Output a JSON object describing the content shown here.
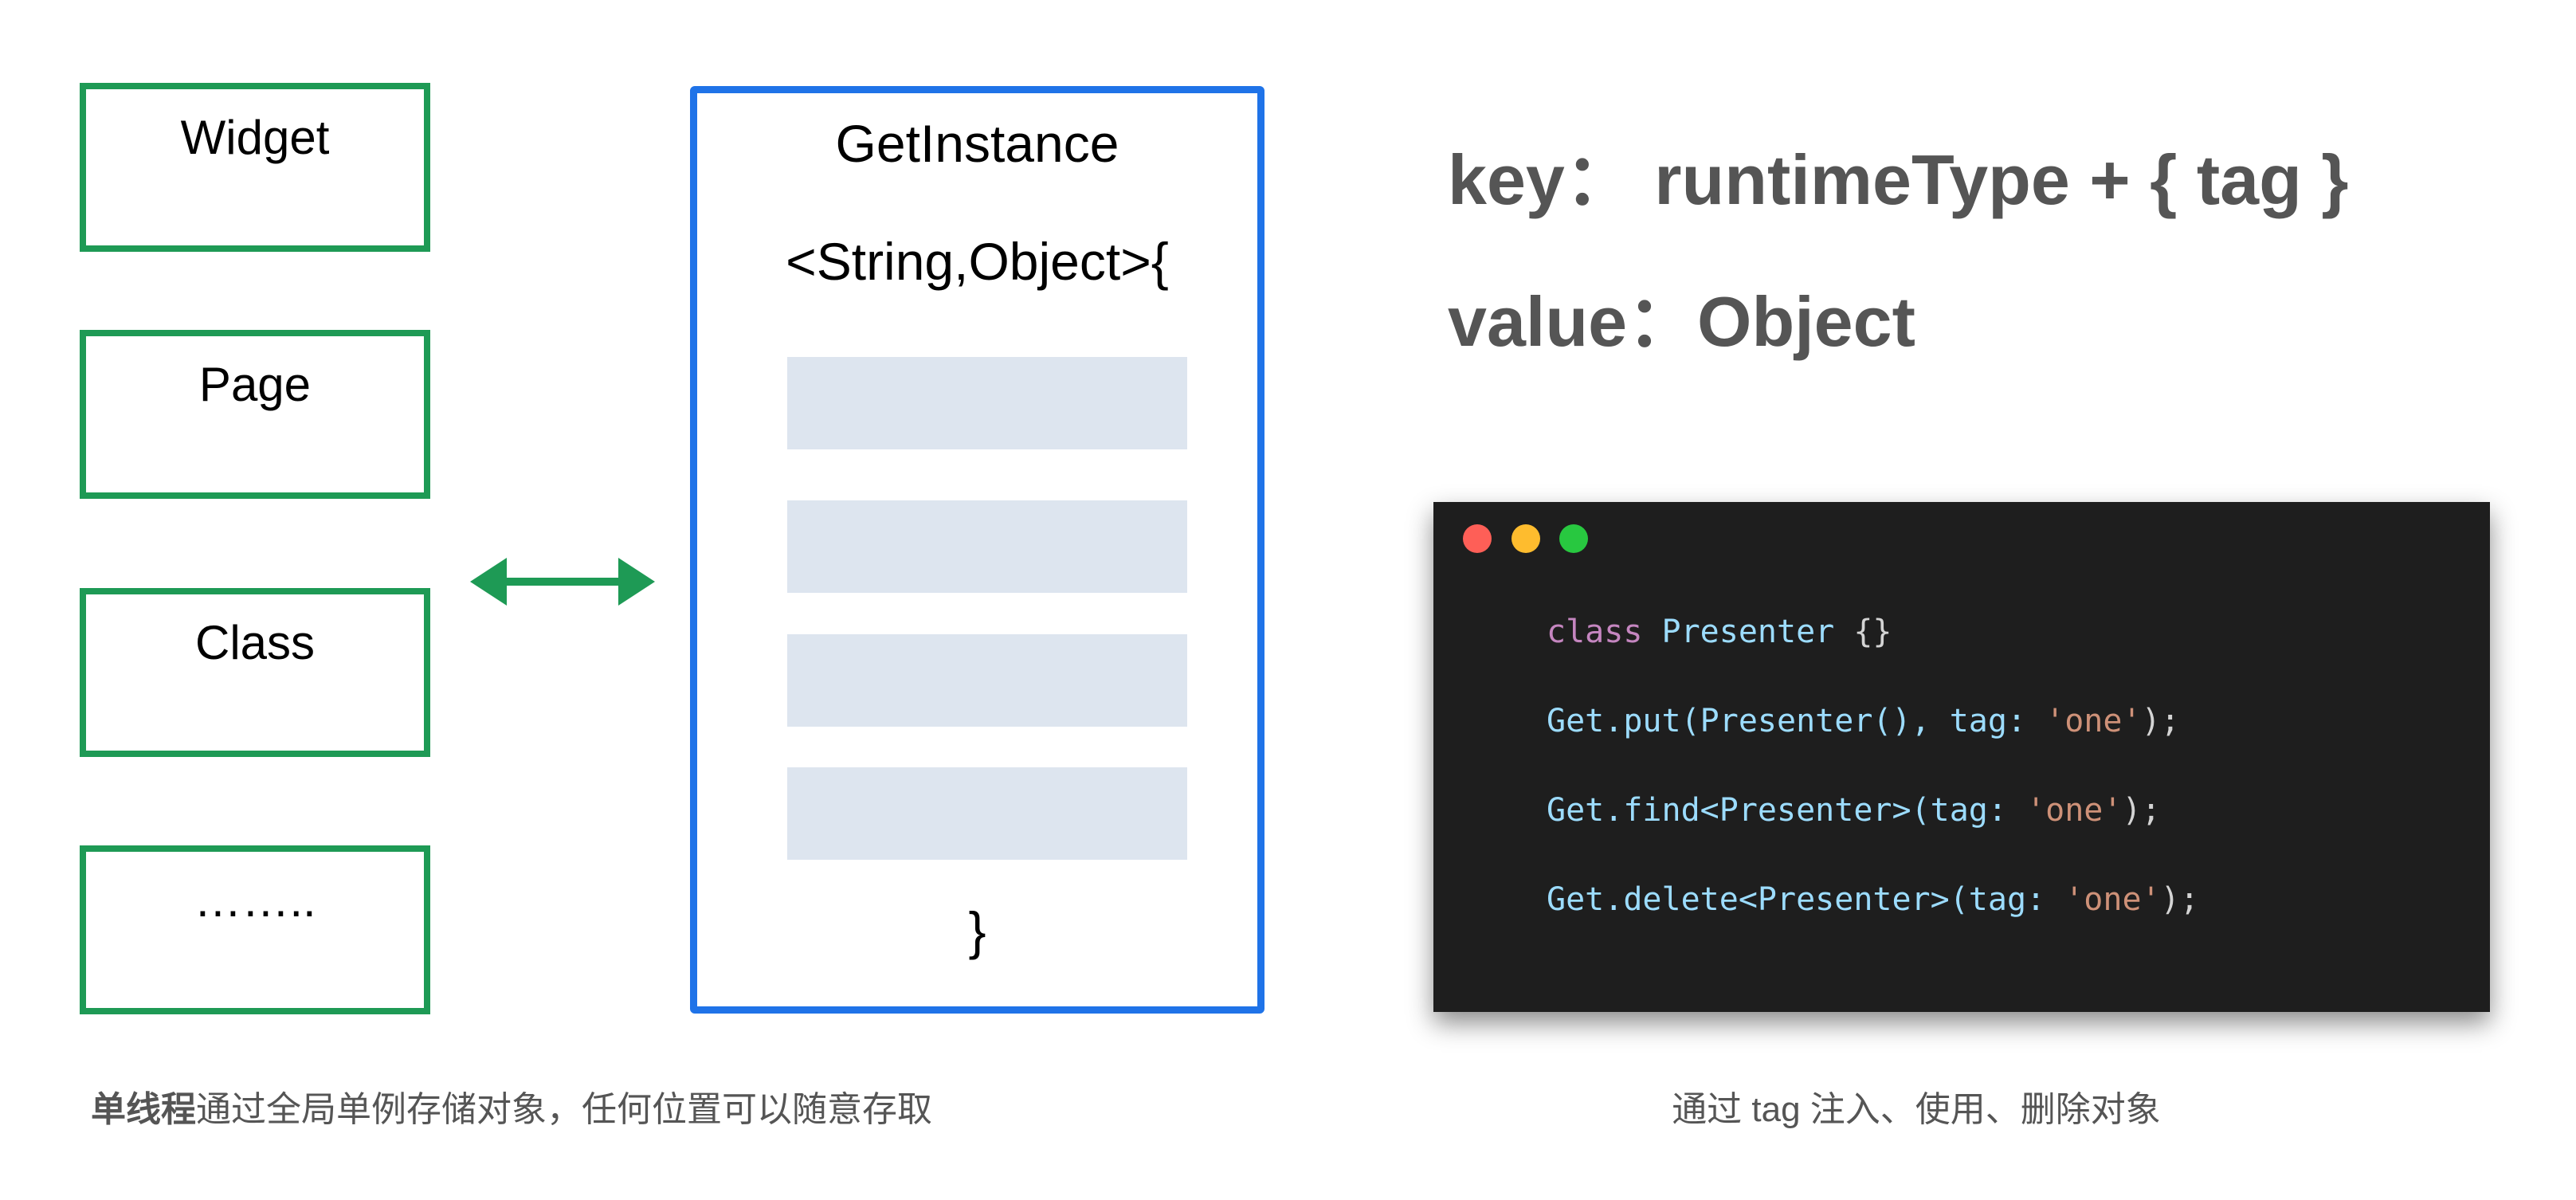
{
  "left_boxes": [
    "Widget",
    "Page",
    "Class",
    "…….."
  ],
  "container": {
    "title": "GetInstance",
    "generic": "<String,Object>{",
    "close": "}",
    "slot_count": 4
  },
  "key_line": {
    "label": "key：",
    "value": "runtimeType + { tag }"
  },
  "value_line": {
    "label": "value：",
    "value": "Object"
  },
  "code": {
    "lines": [
      [
        {
          "t": "class ",
          "c": "kw"
        },
        {
          "t": "Presenter ",
          "c": "cl"
        },
        {
          "t": "{}",
          "c": "pn"
        }
      ],
      [
        {
          "t": "Get.put(Presenter(), tag: ",
          "c": "cl"
        },
        {
          "t": "'one'",
          "c": "str"
        },
        {
          "t": ");",
          "c": "pn"
        }
      ],
      [
        {
          "t": "Get.find<Presenter>(tag: ",
          "c": "cl"
        },
        {
          "t": "'one'",
          "c": "str"
        },
        {
          "t": ");",
          "c": "pn"
        }
      ],
      [
        {
          "t": "Get.delete<Presenter>(tag: ",
          "c": "cl"
        },
        {
          "t": "'one'",
          "c": "str"
        },
        {
          "t": ");",
          "c": "pn"
        }
      ]
    ],
    "dots": [
      "#fe5f57",
      "#febc2e",
      "#28c840"
    ]
  },
  "captions": {
    "left_bold": "单线程",
    "left_rest": "通过全局单例存储对象，任何位置可以随意存取",
    "right": "通过 tag 注入、使用、删除对象"
  },
  "colors": {
    "green": "#1e9a55",
    "blue": "#1f73e8",
    "slot": "#dde5ef"
  }
}
